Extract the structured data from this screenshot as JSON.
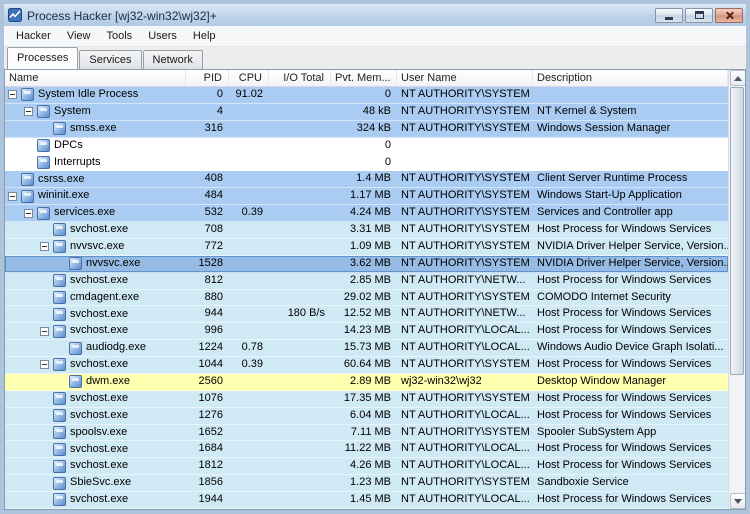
{
  "window": {
    "title": "Process Hacker [wj32-win32\\wj32]+"
  },
  "menu": [
    "Hacker",
    "View",
    "Tools",
    "Users",
    "Help"
  ],
  "tabs": [
    "Processes",
    "Services",
    "Network"
  ],
  "active_tab": "Processes",
  "icons": {
    "app-icon": "process-hacker-logo",
    "expander-icon": "collapse-minus-box",
    "process-icon": "generic-application",
    "minimize-button": "minimize-bar",
    "maximize-button": "maximize-square",
    "close-button": "close-x",
    "scroll-up-icon": "triangle-up",
    "scroll-down-icon": "triangle-down"
  },
  "colors": {
    "system": "#aaccf2",
    "service": "#cfe9f5",
    "own": "#ffffb0",
    "selected": "#96bbe4",
    "default": "#ffffff",
    "titlebar": "#bdd2ea",
    "window_border": "#aec4dd"
  },
  "columns": [
    {
      "label": "Name",
      "align": "left"
    },
    {
      "label": "PID",
      "align": "right"
    },
    {
      "label": "CPU",
      "align": "right"
    },
    {
      "label": "I/O Total",
      "align": "right"
    },
    {
      "label": "Pvt. Mem...",
      "align": "left"
    },
    {
      "label": "User Name",
      "align": "left"
    },
    {
      "label": "Description",
      "align": "left"
    }
  ],
  "rows": [
    {
      "name": "System Idle Process",
      "level": 0,
      "expander": true,
      "pid": "0",
      "cpu": "91.02",
      "io": "",
      "mem": "0",
      "user": "NT AUTHORITY\\SYSTEM",
      "desc": "",
      "type": "system"
    },
    {
      "name": "System",
      "level": 1,
      "expander": true,
      "pid": "4",
      "cpu": "",
      "io": "",
      "mem": "48 kB",
      "user": "NT AUTHORITY\\SYSTEM",
      "desc": "NT Kernel & System",
      "type": "system"
    },
    {
      "name": "smss.exe",
      "level": 2,
      "expander": false,
      "pid": "316",
      "cpu": "",
      "io": "",
      "mem": "324 kB",
      "user": "NT AUTHORITY\\SYSTEM",
      "desc": "Windows Session Manager",
      "type": "system"
    },
    {
      "name": "DPCs",
      "level": 1,
      "expander": false,
      "pid": "",
      "cpu": "",
      "io": "",
      "mem": "0",
      "user": "",
      "desc": "",
      "type": "default"
    },
    {
      "name": "Interrupts",
      "level": 1,
      "expander": false,
      "pid": "",
      "cpu": "",
      "io": "",
      "mem": "0",
      "user": "",
      "desc": "",
      "type": "default"
    },
    {
      "name": "csrss.exe",
      "level": 0,
      "expander": false,
      "pid": "408",
      "cpu": "",
      "io": "",
      "mem": "1.4 MB",
      "user": "NT AUTHORITY\\SYSTEM",
      "desc": "Client Server Runtime Process",
      "type": "system"
    },
    {
      "name": "wininit.exe",
      "level": 0,
      "expander": true,
      "pid": "484",
      "cpu": "",
      "io": "",
      "mem": "1.17 MB",
      "user": "NT AUTHORITY\\SYSTEM",
      "desc": "Windows Start-Up Application",
      "type": "system"
    },
    {
      "name": "services.exe",
      "level": 1,
      "expander": true,
      "pid": "532",
      "cpu": "0.39",
      "io": "",
      "mem": "4.24 MB",
      "user": "NT AUTHORITY\\SYSTEM",
      "desc": "Services and Controller app",
      "type": "system"
    },
    {
      "name": "svchost.exe",
      "level": 2,
      "expander": false,
      "pid": "708",
      "cpu": "",
      "io": "",
      "mem": "3.31 MB",
      "user": "NT AUTHORITY\\SYSTEM",
      "desc": "Host Process for Windows Services",
      "type": "service"
    },
    {
      "name": "nvvsvc.exe",
      "level": 2,
      "expander": true,
      "pid": "772",
      "cpu": "",
      "io": "",
      "mem": "1.09 MB",
      "user": "NT AUTHORITY\\SYSTEM",
      "desc": "NVIDIA Driver Helper Service, Version...",
      "type": "service"
    },
    {
      "name": "nvvsvc.exe",
      "level": 3,
      "expander": false,
      "pid": "1528",
      "cpu": "",
      "io": "",
      "mem": "3.62 MB",
      "user": "NT AUTHORITY\\SYSTEM",
      "desc": "NVIDIA Driver Helper Service, Version...",
      "type": "service",
      "selected": true
    },
    {
      "name": "svchost.exe",
      "level": 2,
      "expander": false,
      "pid": "812",
      "cpu": "",
      "io": "",
      "mem": "2.85 MB",
      "user": "NT AUTHORITY\\NETW...",
      "desc": "Host Process for Windows Services",
      "type": "service"
    },
    {
      "name": "cmdagent.exe",
      "level": 2,
      "expander": false,
      "pid": "880",
      "cpu": "",
      "io": "",
      "mem": "29.02 MB",
      "user": "NT AUTHORITY\\SYSTEM",
      "desc": "COMODO Internet Security",
      "type": "service"
    },
    {
      "name": "svchost.exe",
      "level": 2,
      "expander": false,
      "pid": "944",
      "cpu": "",
      "io": "180 B/s",
      "mem": "12.52 MB",
      "user": "NT AUTHORITY\\NETW...",
      "desc": "Host Process for Windows Services",
      "type": "service"
    },
    {
      "name": "svchost.exe",
      "level": 2,
      "expander": true,
      "pid": "996",
      "cpu": "",
      "io": "",
      "mem": "14.23 MB",
      "user": "NT AUTHORITY\\LOCAL...",
      "desc": "Host Process for Windows Services",
      "type": "service"
    },
    {
      "name": "audiodg.exe",
      "level": 3,
      "expander": false,
      "pid": "1224",
      "cpu": "0.78",
      "io": "",
      "mem": "15.73 MB",
      "user": "NT AUTHORITY\\LOCAL...",
      "desc": "Windows Audio Device Graph Isolati...",
      "type": "service"
    },
    {
      "name": "svchost.exe",
      "level": 2,
      "expander": true,
      "pid": "1044",
      "cpu": "0.39",
      "io": "",
      "mem": "60.64 MB",
      "user": "NT AUTHORITY\\SYSTEM",
      "desc": "Host Process for Windows Services",
      "type": "service"
    },
    {
      "name": "dwm.exe",
      "level": 3,
      "expander": false,
      "pid": "2560",
      "cpu": "",
      "io": "",
      "mem": "2.89 MB",
      "user": "wj32-win32\\wj32",
      "desc": "Desktop Window Manager",
      "type": "own"
    },
    {
      "name": "svchost.exe",
      "level": 2,
      "expander": false,
      "pid": "1076",
      "cpu": "",
      "io": "",
      "mem": "17.35 MB",
      "user": "NT AUTHORITY\\SYSTEM",
      "desc": "Host Process for Windows Services",
      "type": "service"
    },
    {
      "name": "svchost.exe",
      "level": 2,
      "expander": false,
      "pid": "1276",
      "cpu": "",
      "io": "",
      "mem": "6.04 MB",
      "user": "NT AUTHORITY\\LOCAL...",
      "desc": "Host Process for Windows Services",
      "type": "service"
    },
    {
      "name": "spoolsv.exe",
      "level": 2,
      "expander": false,
      "pid": "1652",
      "cpu": "",
      "io": "",
      "mem": "7.11 MB",
      "user": "NT AUTHORITY\\SYSTEM",
      "desc": "Spooler SubSystem App",
      "type": "service"
    },
    {
      "name": "svchost.exe",
      "level": 2,
      "expander": false,
      "pid": "1684",
      "cpu": "",
      "io": "",
      "mem": "11.22 MB",
      "user": "NT AUTHORITY\\LOCAL...",
      "desc": "Host Process for Windows Services",
      "type": "service"
    },
    {
      "name": "svchost.exe",
      "level": 2,
      "expander": false,
      "pid": "1812",
      "cpu": "",
      "io": "",
      "mem": "4.26 MB",
      "user": "NT AUTHORITY\\LOCAL...",
      "desc": "Host Process for Windows Services",
      "type": "service"
    },
    {
      "name": "SbieSvc.exe",
      "level": 2,
      "expander": false,
      "pid": "1856",
      "cpu": "",
      "io": "",
      "mem": "1.23 MB",
      "user": "NT AUTHORITY\\SYSTEM",
      "desc": "Sandboxie Service",
      "type": "service"
    },
    {
      "name": "svchost.exe",
      "level": 2,
      "expander": false,
      "pid": "1944",
      "cpu": "",
      "io": "",
      "mem": "1.45 MB",
      "user": "NT AUTHORITY\\LOCAL...",
      "desc": "Host Process for Windows Services",
      "type": "service"
    }
  ]
}
